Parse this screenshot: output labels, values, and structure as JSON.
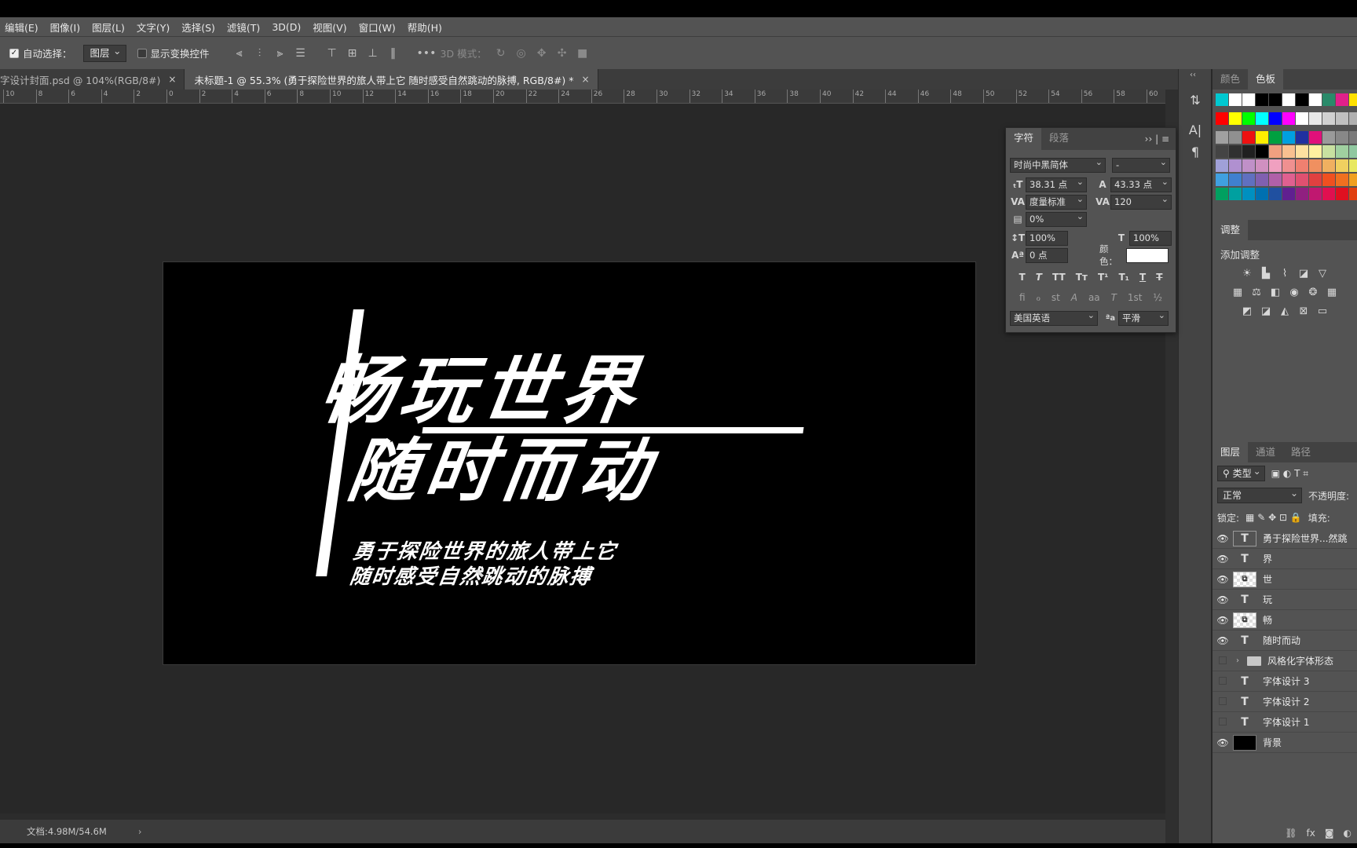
{
  "menu": [
    "编辑(E)",
    "图像(I)",
    "图层(L)",
    "文字(Y)",
    "选择(S)",
    "滤镜(T)",
    "3D(D)",
    "视图(V)",
    "窗口(W)",
    "帮助(H)"
  ],
  "options": {
    "auto_select_label": "自动选择：",
    "auto_select_value": "图层",
    "show_transform_label": "显示变换控件",
    "mode3d_label": "3D 模式："
  },
  "tabs": [
    {
      "label": "字设计封面.psd @ 104%(RGB/8#)",
      "close": "×"
    },
    {
      "label": "未标题-1 @ 55.3% (勇于探险世界的旅人带上它 随时感受自然跳动的脉搏, RGB/8#) *",
      "close": "×"
    }
  ],
  "ruler_labels": [
    "10",
    "8",
    "6",
    "4",
    "2",
    "0",
    "2",
    "4",
    "6",
    "8",
    "10",
    "12",
    "14",
    "16",
    "18",
    "20",
    "22",
    "24",
    "26",
    "28",
    "30",
    "32",
    "34",
    "36",
    "38",
    "40",
    "42",
    "44",
    "46",
    "48",
    "50",
    "52",
    "54",
    "56",
    "58",
    "60"
  ],
  "canvas": {
    "line1": "畅玩世界",
    "line2": "随时而动",
    "sub1": "勇于探险世界的旅人带上它",
    "sub2": "随时感受自然跳动的脉搏"
  },
  "status": {
    "doc": "文档:4.98M/54.6M",
    "arrow": "›"
  },
  "character": {
    "tab_char": "字符",
    "tab_para": "段落",
    "font": "时尚中黑简体",
    "style": "-",
    "size": "38.31 点",
    "leading": "43.33 点",
    "kerning": "度量标准",
    "tracking": "120",
    "tsume": "0%",
    "vscale": "100%",
    "hscale": "100%",
    "baseline": "0 点",
    "color_label": "颜色：",
    "language": "美国英语",
    "antialias_label": "ªa",
    "antialias": "平滑",
    "type_buttons": [
      "T",
      "T",
      "TT",
      "Tт",
      "T¹",
      "T₁",
      "T",
      "T"
    ],
    "ot_buttons": [
      "ﬁ",
      "ℴ",
      "st",
      "A",
      "aa",
      "T",
      "1st",
      "½"
    ]
  },
  "swatches": {
    "tab_color": "颜色",
    "tab_swatches": "色板",
    "rows": [
      [
        "#00c8d0",
        "#ffffff",
        "#ffffff",
        "#000000",
        "#000000",
        "#ffffff",
        "#000000",
        "#ffffff",
        "#2a8a6a",
        "#e0208a",
        "#ffe000"
      ],
      [
        "#ff0000",
        "#ffff00",
        "#00ff00",
        "#00ffff",
        "#0000ff",
        "#ff00ff",
        "#ffffff",
        "#e8e8e8",
        "#d0d0d0",
        "#c0c0c0",
        "#b0b0b0"
      ],
      [
        "#a0a0a0",
        "#909090",
        "#ee1111",
        "#ffee00",
        "#00a040",
        "#00a0e0",
        "#2030a0",
        "#e0107a",
        "#9a9a9a",
        "#888888",
        "#7a7a7a"
      ],
      [
        "#444444",
        "#303030",
        "#202020",
        "#000000",
        "#f0a080",
        "#f8c090",
        "#fde0a0",
        "#fff0a0",
        "#c8e0a0",
        "#a0d0a0",
        "#90c8a0"
      ],
      [
        "#a0a0d8",
        "#b090d0",
        "#c090c8",
        "#d090c0",
        "#f0a0c0",
        "#f09090",
        "#f08070",
        "#f09060",
        "#f0b060",
        "#f0d060",
        "#e8e860"
      ],
      [
        "#40a0e0",
        "#4080d0",
        "#6070c0",
        "#8060b0",
        "#b060a8",
        "#e06090",
        "#e05070",
        "#e04040",
        "#f05020",
        "#f07020",
        "#f0a020"
      ],
      [
        "#00a060",
        "#00a0a0",
        "#0090c0",
        "#0070b0",
        "#2050a0",
        "#602090",
        "#902080",
        "#c01870",
        "#e01050",
        "#e01020",
        "#e04010"
      ]
    ]
  },
  "adjustments": {
    "tab": "调整",
    "title": "添加调整"
  },
  "layers": {
    "tabs": [
      "图层",
      "通道",
      "路径"
    ],
    "filter": "类型",
    "blend": "正常",
    "opacity_label": "不透明度:",
    "lock_label": "锁定:",
    "fill_label": "填充:",
    "items": [
      {
        "name": "勇于探险世界...然跳",
        "kind": "text",
        "visible": true
      },
      {
        "name": "界",
        "kind": "text",
        "visible": true
      },
      {
        "name": "世",
        "kind": "smart",
        "visible": true
      },
      {
        "name": "玩",
        "kind": "text",
        "visible": true
      },
      {
        "name": "畅",
        "kind": "smart",
        "visible": true
      },
      {
        "name": "随时而动",
        "kind": "text",
        "visible": true
      },
      {
        "name": "风格化字体形态",
        "kind": "group",
        "visible": false
      },
      {
        "name": "字体设计 3",
        "kind": "text",
        "visible": false
      },
      {
        "name": "字体设计 2",
        "kind": "text",
        "visible": false
      },
      {
        "name": "字体设计 1",
        "kind": "text",
        "visible": false
      },
      {
        "name": "背景",
        "kind": "bg",
        "visible": true
      }
    ]
  }
}
